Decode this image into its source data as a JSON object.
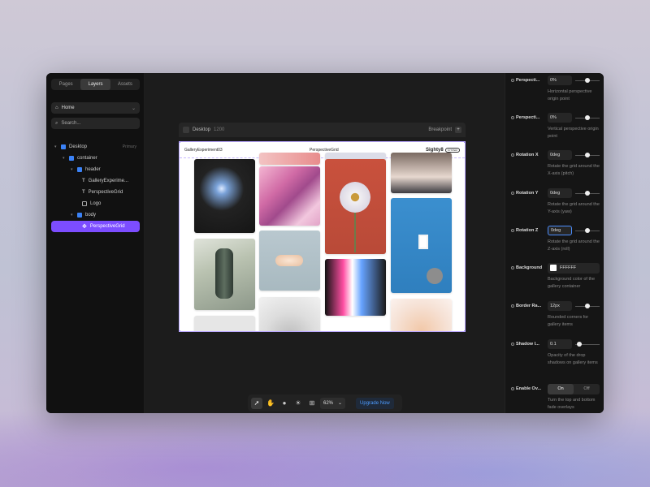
{
  "sidebar": {
    "tabs": [
      "Pages",
      "Layers",
      "Assets"
    ],
    "active_tab": "Layers",
    "page_select": "Home",
    "search_placeholder": "Search...",
    "tree": [
      {
        "label": "Desktop",
        "tag": "Primary",
        "icon": "frame-icon"
      },
      {
        "label": "container",
        "tag": "",
        "icon": "stack-icon"
      },
      {
        "label": "header",
        "tag": "",
        "icon": "stack-icon"
      },
      {
        "label": "GalleryExperime...",
        "tag": "",
        "icon": "text-icon"
      },
      {
        "label": "PerspectiveGrid",
        "tag": "",
        "icon": "text-icon"
      },
      {
        "label": "Logo",
        "tag": "",
        "icon": "image-icon"
      },
      {
        "label": "body",
        "tag": "",
        "icon": "stack-icon"
      },
      {
        "label": "PerspectiveGrid",
        "tag": "",
        "icon": "component-icon"
      }
    ]
  },
  "canvas": {
    "frame_name": "Desktop",
    "frame_width": "1200",
    "breakpoint_label": "Breakpoint",
    "header_left": "GalleryExperiment03",
    "header_center": "PerspectiveGrid",
    "header_logo": "Sighty8",
    "header_logo_pill": "SYSTEM"
  },
  "toolbar": {
    "zoom": "62%",
    "upgrade_label": "Upgrade Now",
    "tools": [
      "pointer-icon",
      "hand-icon",
      "comment-icon",
      "sun-icon",
      "grid-icon"
    ]
  },
  "panel": {
    "props": [
      {
        "label": "Perspecti...",
        "value": "0%",
        "level": 0.5,
        "desc": "Horizontal perspective origin point"
      },
      {
        "label": "Perspecti...",
        "value": "0%",
        "level": 0.5,
        "desc": "Vertical perspective origin point"
      },
      {
        "label": "Rotation X",
        "value": "0deg",
        "level": 0.5,
        "desc": "Rotate the grid around the X-axis (pitch)"
      },
      {
        "label": "Rotation Y",
        "value": "0deg",
        "level": 0.5,
        "desc": "Rotate the grid around the Y-axis (yaw)"
      },
      {
        "label": "Rotation Z",
        "value": "0deg",
        "level": 0.5,
        "desc": "Rotate the grid around the Z-axis (roll)"
      }
    ],
    "background_label": "Background",
    "background_value": "FFFFFF",
    "background_desc": "Background color of the gallery container",
    "border_label": "Border Ra...",
    "border_value": "12px",
    "border_level": 0.5,
    "border_desc": "Rounded corners for gallery items",
    "shadow_label": "Shadow I...",
    "shadow_value": "0.1",
    "shadow_level": 0.1,
    "shadow_desc": "Opacity of the drop shadows on gallery items",
    "overlay_label": "Enable Ov...",
    "overlay_on": "On",
    "overlay_off": "Off",
    "overlay_desc": "Turn the top and bottom fade overlays"
  },
  "colors": {
    "accent": "#7c4dff",
    "focus": "#4d8fff",
    "upgrade_text": "#4d9cff"
  }
}
